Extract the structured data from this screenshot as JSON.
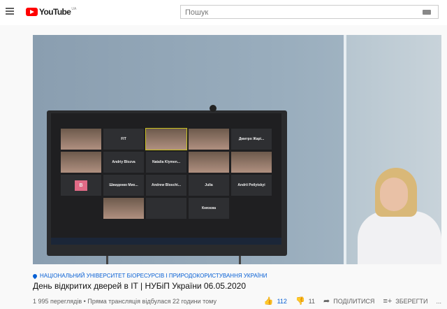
{
  "header": {
    "logo_text": "YouTube",
    "region": "UA",
    "search_placeholder": "Пошук"
  },
  "video": {
    "tiles": [
      "",
      "FIT",
      "",
      "",
      "Дмитро Жарі...",
      "",
      "Andriy Blozva",
      "Natalia Klymen...",
      "",
      "",
      "B",
      "Швиденко Мих...",
      "Andrew Bloschi...",
      "Julia",
      "Andrii Petlytskyi",
      "",
      "",
      "",
      "Князєва",
      ""
    ]
  },
  "meta": {
    "channel": "НАЦІОНАЛЬНИЙ УНІВЕРСИТЕТ БІОРЕСУРСІВ І ПРИРОДОКОРИСТУВАННЯ УКРАЇНИ",
    "title": "День відкритих дверей в IT | НУБіП України 06.05.2020",
    "views": "1 995 переглядів",
    "separator": "•",
    "streamed": "Пряма трансляція відбулася 22 години тому",
    "likes": "112",
    "dislikes": "11",
    "share": "ПОДІЛИТИСЯ",
    "save": "ЗБЕРЕГТИ",
    "more": "..."
  },
  "colors": {
    "accent": "#065fd4",
    "brand": "#ff0000"
  }
}
